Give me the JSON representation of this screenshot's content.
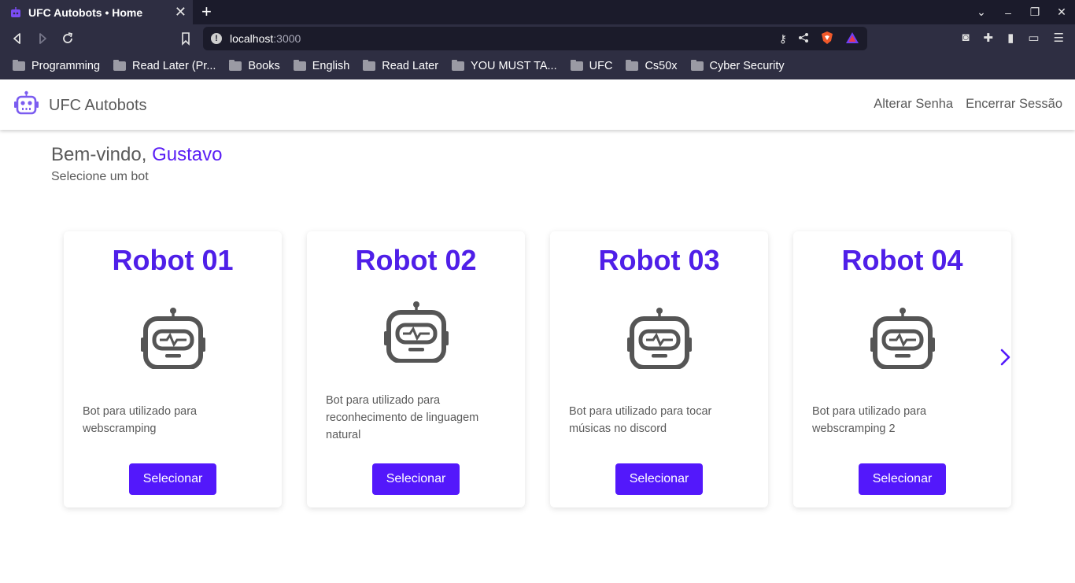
{
  "browser": {
    "tab_title": "UFC Autobots • Home",
    "tab_close": "✕",
    "new_tab": "+",
    "url_host": "localhost",
    "url_port": ":3000",
    "window_controls": [
      "⌄",
      "–",
      "❐",
      "✕"
    ],
    "bookmarks": [
      {
        "label": "Programming"
      },
      {
        "label": "Read Later (Pr..."
      },
      {
        "label": "Books"
      },
      {
        "label": "English"
      },
      {
        "label": "Read Later"
      },
      {
        "label": "YOU MUST TA..."
      },
      {
        "label": "UFC"
      },
      {
        "label": "Cs50x"
      },
      {
        "label": "Cyber Security"
      }
    ]
  },
  "app": {
    "brand": "UFC Autobots",
    "nav": {
      "change_password": "Alterar Senha",
      "logout": "Encerrar Sessão"
    },
    "welcome_prefix": "Bem-vindo,",
    "user_name": "Gustavo",
    "subtitle": "Selecione um bot",
    "accent_color": "#5318fb",
    "bots": [
      {
        "title": "Robot 01",
        "description": "Bot para utilizado para webscramping",
        "button": "Selecionar"
      },
      {
        "title": "Robot 02",
        "description": "Bot para utilizado para reconhecimento de linguagem natural",
        "button": "Selecionar"
      },
      {
        "title": "Robot 03",
        "description": "Bot para utilizado para tocar músicas no discord",
        "button": "Selecionar"
      },
      {
        "title": "Robot 04",
        "description": "Bot para utilizado para webscramping 2",
        "button": "Selecionar"
      }
    ]
  }
}
